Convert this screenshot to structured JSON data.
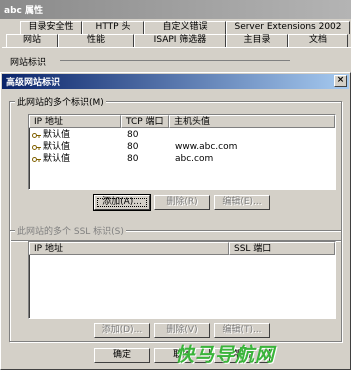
{
  "background_window": {
    "title": "abc 属性",
    "tabs_row1": [
      "目录安全性",
      "HTTP 头",
      "自定义错误",
      "Server Extensions 2002"
    ],
    "tabs_row2": [
      "网站",
      "性能",
      "ISAPI 筛选器",
      "主目录",
      "文档"
    ],
    "group_label": "网站标识"
  },
  "dialog": {
    "title": "高级网站标识",
    "close_glyph": "×",
    "identities_group": {
      "label": "此网站的多个标识(M)",
      "columns": [
        "IP 地址",
        "TCP 端口",
        "主机头值"
      ],
      "rows": [
        {
          "ip": "默认值",
          "port": "80",
          "host": ""
        },
        {
          "ip": "默认值",
          "port": "80",
          "host": "www.abc.com"
        },
        {
          "ip": "默认值",
          "port": "80",
          "host": "abc.com"
        }
      ],
      "buttons": {
        "add": "添加(A)...",
        "remove": "删除(R)",
        "edit": "编辑(E)..."
      }
    },
    "ssl_group": {
      "label": "此网站的多个 SSL 标识(S)",
      "columns": [
        "IP 地址",
        "SSL 端口"
      ],
      "buttons": {
        "add": "添加(D)...",
        "remove": "删除(V)",
        "edit": "编辑(T)..."
      }
    },
    "footer": {
      "ok": "确定",
      "cancel": "取消",
      "help": "帮助"
    }
  },
  "watermark": "快马导航网",
  "colors": {
    "face": "#d4d0c8",
    "title_active": "#0a246a",
    "title_inactive": "#8a8a8a"
  }
}
